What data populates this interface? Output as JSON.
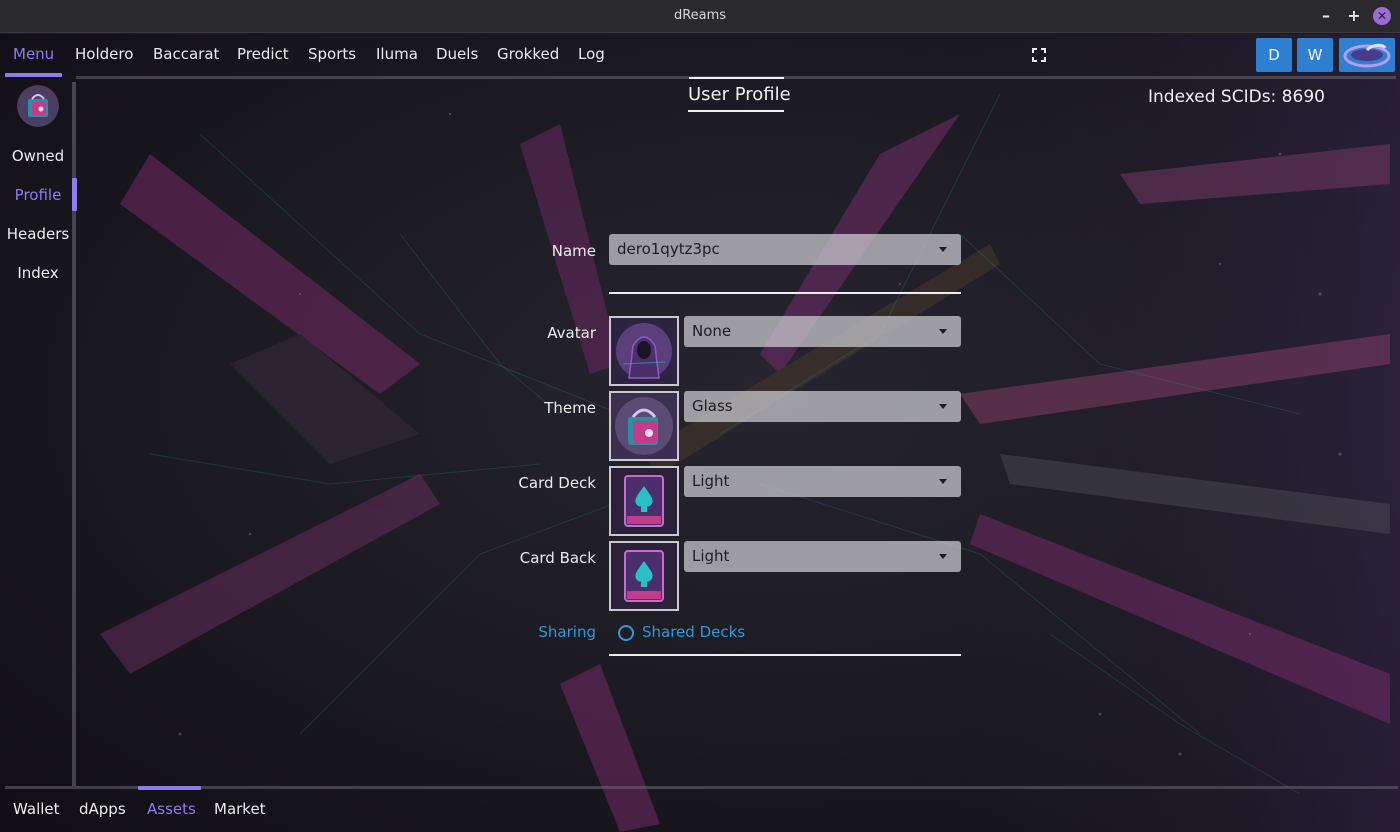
{
  "window": {
    "title": "dReams"
  },
  "top_tabs": [
    "Menu",
    "Holdero",
    "Baccarat",
    "Predict",
    "Sports",
    "Iluma",
    "Duels",
    "Grokked",
    "Log"
  ],
  "account_buttons": {
    "d": "D",
    "w": "W"
  },
  "sidebar": {
    "items": [
      "Owned",
      "Profile",
      "Headers",
      "Index"
    ],
    "active": "Profile"
  },
  "header": {
    "title": "User Profile",
    "indexed_scids": "Indexed SCIDs: 8690"
  },
  "form": {
    "name_label": "Name",
    "name_value": "dero1qytz3pc",
    "avatar_label": "Avatar",
    "avatar_value": "None",
    "theme_label": "Theme",
    "theme_value": "Glass",
    "card_deck_label": "Card Deck",
    "card_deck_value": "Light",
    "card_back_label": "Card Back",
    "card_back_value": "Light",
    "sharing_label": "Sharing",
    "shared_decks_label": "Shared Decks",
    "shared_decks_checked": false
  },
  "bottom_nav": {
    "items": [
      "Wallet",
      "dApps",
      "Assets",
      "Market"
    ],
    "active": "Assets"
  },
  "colors": {
    "accent": "#8e7cf2",
    "link": "#2e9ad8",
    "account_button": "#2f7fd0"
  }
}
